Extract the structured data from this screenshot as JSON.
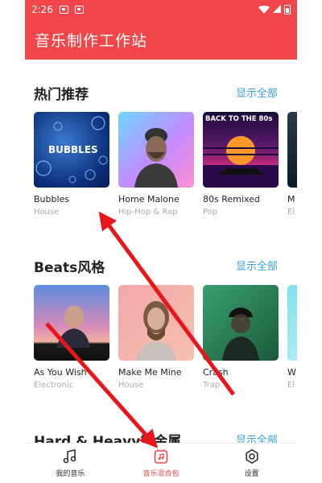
{
  "status": {
    "time": "2:26"
  },
  "app": {
    "title": "音乐制作工作站"
  },
  "sections": [
    {
      "title": "热门推荐",
      "more": "显示全部",
      "cards": [
        {
          "title": "Bubbles",
          "genre": "House",
          "art_text": "BUBBLES"
        },
        {
          "title": "Home Malone",
          "genre": "Hip-Hop & Rap",
          "art_text": ""
        },
        {
          "title": "80s Remixed",
          "genre": "Pop",
          "art_text": "BACK TO THE 80s"
        },
        {
          "title": "M",
          "genre": "El",
          "art_text": ""
        }
      ]
    },
    {
      "title": "Beats风格",
      "more": "显示全部",
      "cards": [
        {
          "title": "As You Wish",
          "genre": "Electronic"
        },
        {
          "title": "Make Me Mine",
          "genre": "House"
        },
        {
          "title": "Crash",
          "genre": "Trap"
        },
        {
          "title": "W",
          "genre": "El"
        }
      ]
    },
    {
      "title": "Hard & Heavy重金属",
      "more": "显示全部"
    }
  ],
  "nav": [
    {
      "label": "我的音乐",
      "icon": "music-note-icon",
      "active": false
    },
    {
      "label": "音乐混合包",
      "icon": "music-pack-icon",
      "active": true
    },
    {
      "label": "设置",
      "icon": "gear-icon",
      "active": false
    }
  ],
  "colors": {
    "accent": "#f2474a",
    "link": "#3aa0d8",
    "annotation": "#e8161b"
  }
}
